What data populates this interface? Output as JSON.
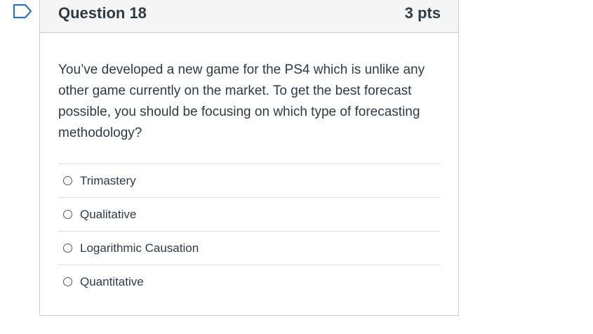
{
  "question": {
    "title": "Question 18",
    "points": "3 pts",
    "text": "You’ve developed a new game for the PS4 which is unlike any other game currently on the market.  To get the best forecast possible, you should be focusing on which type of forecasting methodology?",
    "answers": [
      {
        "label": "Trimastery"
      },
      {
        "label": "Qualitative"
      },
      {
        "label": "Logarithmic Causation"
      },
      {
        "label": "Quantitative"
      }
    ]
  },
  "icons": {
    "flag": "bookmark-flag-icon"
  },
  "colors": {
    "accent": "#2d72c5",
    "text": "#2d3b45",
    "header_bg": "#f5f5f5",
    "border": "#c7cdd1"
  }
}
